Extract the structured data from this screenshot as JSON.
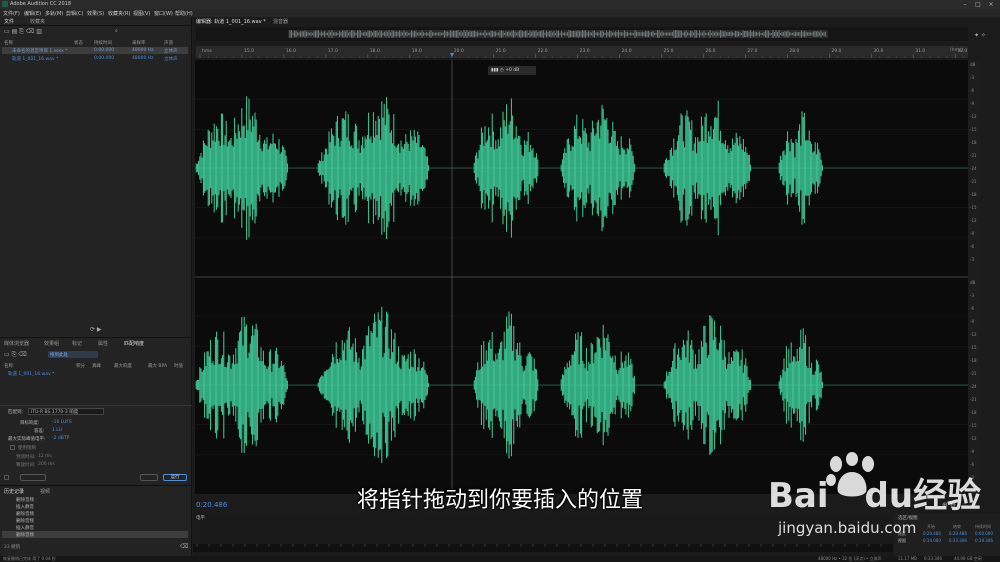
{
  "app": {
    "title": "Adobe Audition CC 2018"
  },
  "menu": [
    "文件(F)",
    "编辑(E)",
    "多轨(M)",
    "剪辑(C)",
    "效果(S)",
    "收藏夹(R)",
    "视图(V)",
    "窗口(W)",
    "帮助(H)"
  ],
  "files_panel": {
    "tabs": [
      "文件",
      "收藏夹"
    ],
    "columns": [
      "名称",
      "状态",
      "持续时间",
      "采样率",
      "声道"
    ],
    "rows": [
      {
        "name": "未命名的混音项目 1.sesx *",
        "duration": "0:00.000",
        "rate": "48000 Hz",
        "channels": "立体声"
      },
      {
        "name": "轨道 1_001_16.wav *",
        "duration": "0:00.000",
        "rate": "48000 Hz",
        "channels": "立体声"
      }
    ]
  },
  "match_panel": {
    "tabs": [
      "媒体浏览器",
      "效果组",
      "标记",
      "属性",
      "匹配响度"
    ],
    "selected_tab_label": "匹配响度",
    "item": "拖到此处",
    "columns": [
      "名称",
      "积分",
      "真峰",
      "最大响度",
      "最大 BPA",
      "时值"
    ],
    "file": "轨道 1_001_16.wav *",
    "settings": {
      "match_label": "匹配到:",
      "match_value": "ITU-R BS.1770-3 响度",
      "target_label": "目标响度:",
      "target_value": "-16 LUFS",
      "tol_label": "容差:",
      "tol_value": "1 LU",
      "peak_label": "最大实际峰值电平:",
      "peak_value": "-2 dBTP",
      "limit_label": "使用限制",
      "look_label": "预测时间:",
      "look_value": "12 ms",
      "release_label": "释放时间:",
      "release_value": "200 ms",
      "run_button": "运行"
    }
  },
  "history_panel": {
    "tabs": [
      "历史记录",
      "视频"
    ],
    "items": [
      "删除音频",
      "插入静音",
      "删除音频",
      "删除音频",
      "插入静音",
      "删除音频"
    ],
    "footer": "23 撤销"
  },
  "editor": {
    "tabs": [
      "编辑器: 轨道 1_001_16.wav *",
      "混音器"
    ],
    "ruler": [
      "hms",
      "15.0",
      "16.0",
      "17.0",
      "18.0",
      "19.0",
      "20.0",
      "21.0",
      "22.0",
      "23.0",
      "24.0",
      "25.0",
      "26.0",
      "27.0",
      "28.0",
      "29.0",
      "30.0",
      "31.0",
      "32.0"
    ],
    "ruler_end": "(hms)",
    "hud_value": "+0 dB",
    "scale_top": [
      "dB",
      "-3",
      "-6",
      "-9",
      "-12",
      "-15",
      "-18",
      "-21",
      "-24",
      "-21",
      "-18",
      "-15",
      "-12",
      "-9",
      "-6",
      "-3"
    ],
    "scale_bottom": [
      "dB",
      "-3",
      "-6",
      "-9",
      "-12",
      "-15",
      "-18",
      "-21",
      "-24",
      "-21",
      "-18",
      "-15",
      "-12",
      "-9",
      "-6",
      "-3"
    ],
    "time": "0:20.486",
    "meter_label": "电平",
    "selection_panel": {
      "title": "选区/视图",
      "headers": [
        "开始",
        "结束",
        "持续时间"
      ],
      "rows": [
        {
          "label": "选区",
          "start": "0:20.486",
          "end": "0:20.486",
          "dur": "0:00.000"
        },
        {
          "label": "视图",
          "start": "0:14.000",
          "end": "0:33.306",
          "dur": "0:19.306"
        }
      ]
    }
  },
  "status": {
    "left": "恢复撤销已完成 用了 0.04 秒",
    "right": [
      "48000 Hz • 32 位 (浮点) • 立体声",
      "11.17 MB",
      "0:33.306",
      "44.99 GB 空闲"
    ]
  },
  "subtitle": "将指针拖动到你要插入的位置",
  "watermark": {
    "brand": "Bai",
    "brand_du": "du",
    "suffix": "经验",
    "url": "jingyan.baidu.com"
  },
  "colors": {
    "wave": "#3fcf9b",
    "accent": "#4a8ee0",
    "playhead": "#555555"
  }
}
